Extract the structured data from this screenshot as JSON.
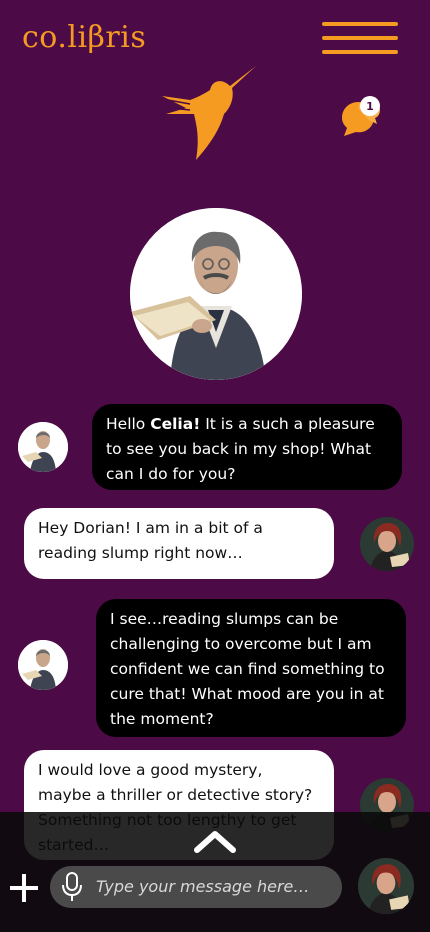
{
  "header": {
    "logo": "co.liβris",
    "notification_count": "1"
  },
  "messages": [
    {
      "sender": "Dorian",
      "side": "left",
      "greeting": "Hello ",
      "name": "Celia!",
      "rest": " It is a such a pleasure to see you back in my shop! What can I do for you?"
    },
    {
      "sender": "Celia",
      "side": "right",
      "text": "Hey Dorian! I am in a bit of a reading slump right now…"
    },
    {
      "sender": "Dorian",
      "side": "left",
      "text": "I see…reading slumps can be challenging to overcome but I am confident we can find something to cure that! What mood are you in at the moment?"
    },
    {
      "sender": "Celia",
      "side": "right",
      "text": "I would love a good mystery, maybe a thriller or detective story? Something not too lengthy to get started…"
    }
  ],
  "composer": {
    "placeholder": "Type your message here…"
  },
  "colors": {
    "background": "#4c0a47",
    "accent": "#f59b22"
  }
}
